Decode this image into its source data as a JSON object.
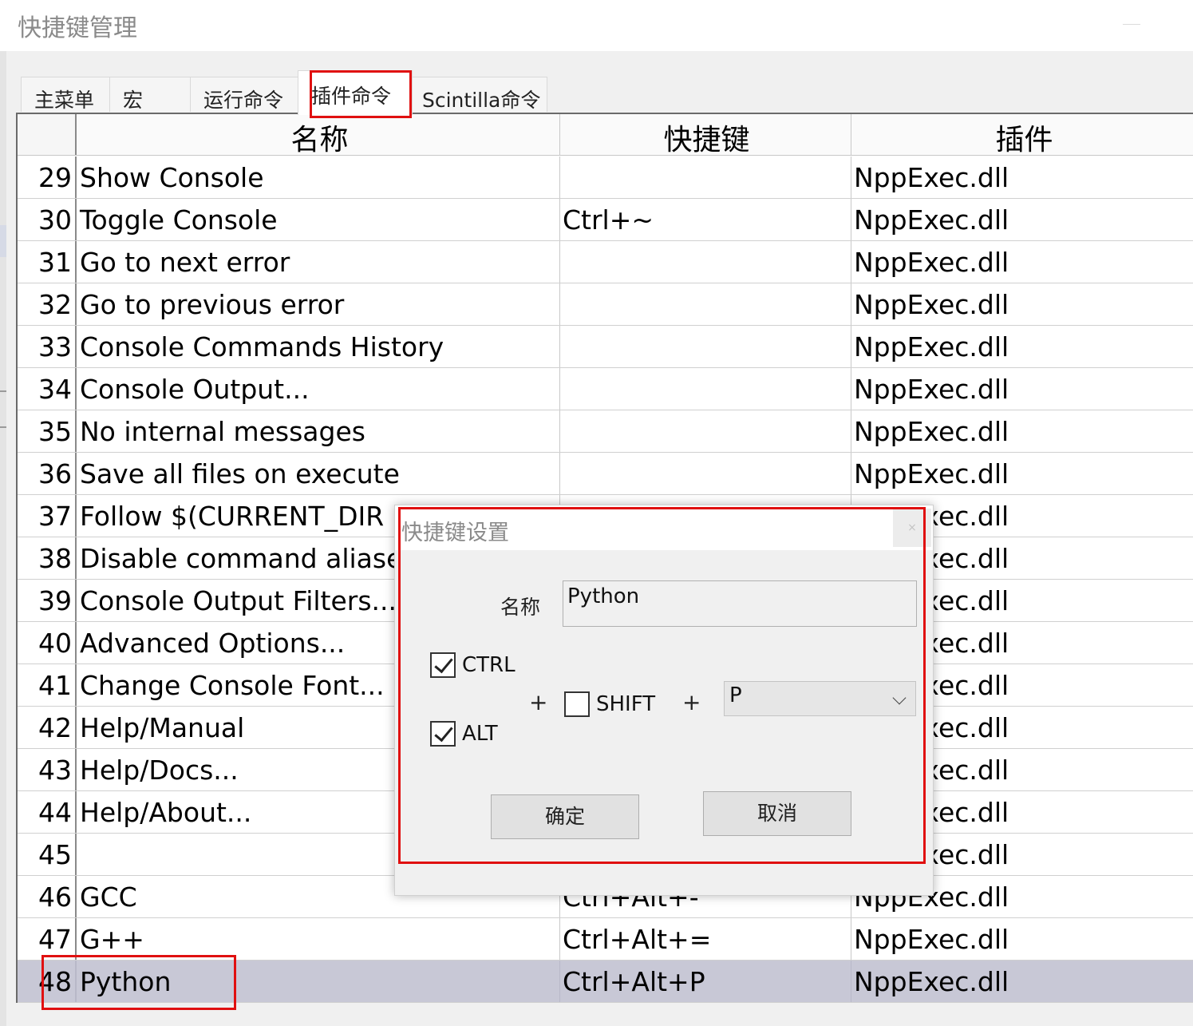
{
  "window": {
    "title": "快捷键管理"
  },
  "tabs": [
    {
      "label": "主菜单"
    },
    {
      "label": "宏"
    },
    {
      "label": "运行命令"
    },
    {
      "label": "插件命令"
    },
    {
      "label": "Scintilla命令"
    }
  ],
  "active_tab_index": 3,
  "table": {
    "columns": {
      "name": "名称",
      "shortcut": "快捷键",
      "plugin": "插件"
    },
    "rows": [
      {
        "num": "29",
        "name": "Show Console",
        "shortcut": "",
        "plugin": "NppExec.dll"
      },
      {
        "num": "30",
        "name": "Toggle Console",
        "shortcut": "Ctrl+~",
        "plugin": "NppExec.dll"
      },
      {
        "num": "31",
        "name": "Go to next error",
        "shortcut": "",
        "plugin": "NppExec.dll"
      },
      {
        "num": "32",
        "name": "Go to previous error",
        "shortcut": "",
        "plugin": "NppExec.dll"
      },
      {
        "num": "33",
        "name": "Console Commands History",
        "shortcut": "",
        "plugin": "NppExec.dll"
      },
      {
        "num": "34",
        "name": "Console Output...",
        "shortcut": "",
        "plugin": "NppExec.dll"
      },
      {
        "num": "35",
        "name": "No internal messages",
        "shortcut": "",
        "plugin": "NppExec.dll"
      },
      {
        "num": "36",
        "name": "Save all files on execute",
        "shortcut": "",
        "plugin": "NppExec.dll"
      },
      {
        "num": "37",
        "name": "Follow $(CURRENT_DIR",
        "shortcut": "",
        "plugin": "NppExec.dll"
      },
      {
        "num": "38",
        "name": "Disable command aliases",
        "shortcut": "",
        "plugin": "NppExec.dll"
      },
      {
        "num": "39",
        "name": "Console Output Filters...",
        "shortcut": "",
        "plugin": "NppExec.dll"
      },
      {
        "num": "40",
        "name": "Advanced Options...",
        "shortcut": "",
        "plugin": "NppExec.dll"
      },
      {
        "num": "41",
        "name": "Change Console Font...",
        "shortcut": "",
        "plugin": "NppExec.dll"
      },
      {
        "num": "42",
        "name": "Help/Manual",
        "shortcut": "",
        "plugin": "NppExec.dll"
      },
      {
        "num": "43",
        "name": "Help/Docs...",
        "shortcut": "",
        "plugin": "NppExec.dll"
      },
      {
        "num": "44",
        "name": "Help/About...",
        "shortcut": "",
        "plugin": "NppExec.dll"
      },
      {
        "num": "45",
        "name": "",
        "shortcut": "",
        "plugin": "NppExec.dll"
      },
      {
        "num": "46",
        "name": "GCC",
        "shortcut": "Ctrl+Alt+-",
        "plugin": "NppExec.dll"
      },
      {
        "num": "47",
        "name": "G++",
        "shortcut": "Ctrl+Alt+=",
        "plugin": "NppExec.dll"
      },
      {
        "num": "48",
        "name": "Python",
        "shortcut": "Ctrl+Alt+P",
        "plugin": "NppExec.dll"
      }
    ],
    "selected_row_num": "48"
  },
  "dialog": {
    "title": "快捷键设置",
    "close_glyph": "×",
    "name_label": "名称",
    "name_value": "Python",
    "ctrl_label": "CTRL",
    "ctrl_checked": true,
    "alt_label": "ALT",
    "alt_checked": true,
    "shift_label": "SHIFT",
    "shift_checked": false,
    "plus_1": "+",
    "plus_2": "+",
    "key_value": "P",
    "ok_label": "确定",
    "cancel_label": "取消"
  },
  "colors": {
    "highlight_red": "#e01010",
    "selected_row": "#c8c8d6"
  }
}
